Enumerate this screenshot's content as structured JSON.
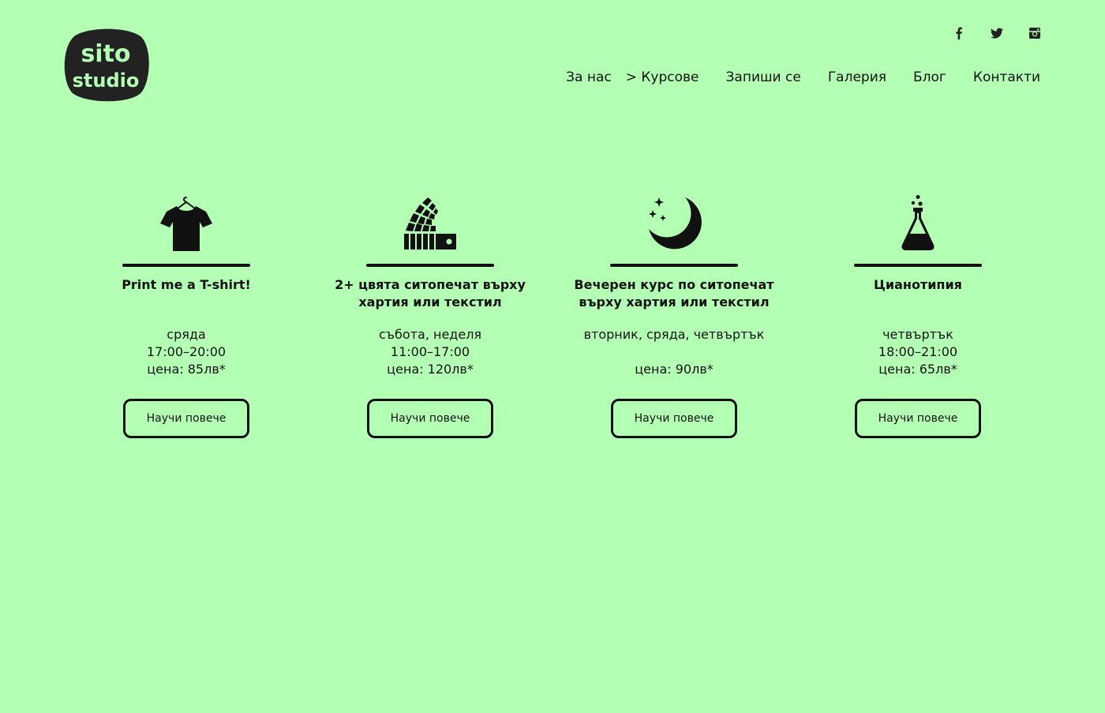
{
  "header": {
    "logo": {
      "line1": "sito",
      "line2": "studio"
    },
    "social": [
      {
        "icon": "facebook-icon"
      },
      {
        "icon": "twitter-icon"
      },
      {
        "icon": "instagram-icon"
      }
    ],
    "nav": [
      {
        "label": "За нас"
      },
      {
        "label": "> Курсове",
        "active": true
      },
      {
        "label": "Запиши се"
      },
      {
        "label": "Галерия"
      },
      {
        "label": "Блог"
      },
      {
        "label": "Контакти"
      }
    ]
  },
  "courses": [
    {
      "icon": "tshirt-icon",
      "title": "Print me a T-shirt!",
      "days": "сряда",
      "time": "17:00–20:00",
      "price": "цена: 85лв*",
      "button": "Научи повече"
    },
    {
      "icon": "color-swatch-fan-icon",
      "title": "2+ цвята ситопечат върху хартия или текстил",
      "days": "събота, неделя",
      "time": "11:00–17:00",
      "price": "цена: 120лв*",
      "button": "Научи повече"
    },
    {
      "icon": "moon-stars-icon",
      "title": "Вечерен курс по ситопечат върху хартия или текстил",
      "days": "вторник, сряда, четвъртък",
      "time": "",
      "price": "цена: 90лв*",
      "button": "Научи повече"
    },
    {
      "icon": "flask-icon",
      "title": "Цианотипия",
      "days": "четвъртък",
      "time": "18:00–21:00",
      "price": "цена: 65лв*",
      "button": "Научи повече"
    }
  ],
  "colors": {
    "background": "#b3ffb3",
    "ink": "#111111",
    "logo_text": "#b3ffb3"
  }
}
